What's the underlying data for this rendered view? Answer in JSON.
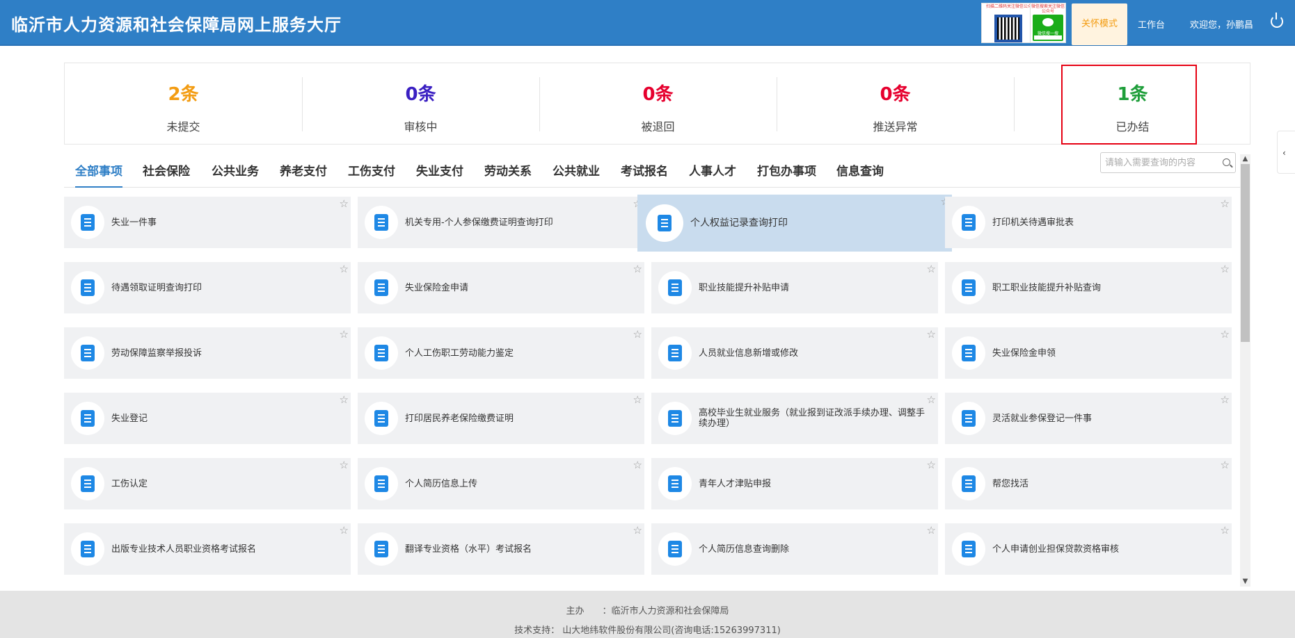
{
  "header": {
    "title": "临沂市人力资源和社会保障局网上服务大厅",
    "qr_caption": "扫描二维码关注微信公众号",
    "wx_caption": "微信搜索关注微信公众号",
    "wx_label": "微信搜一搜",
    "care_mode": "关怀模式",
    "workbench": "工作台",
    "welcome": "欢迎您，孙鹏昌"
  },
  "stats": [
    {
      "count": "2条",
      "label": "未提交",
      "color": "#f39c12"
    },
    {
      "count": "0条",
      "label": "审核中",
      "color": "#3a1fc2"
    },
    {
      "count": "0条",
      "label": "被退回",
      "color": "#e6002e"
    },
    {
      "count": "0条",
      "label": "推送异常",
      "color": "#e6002e"
    },
    {
      "count": "1条",
      "label": "已办结",
      "color": "#1e9e3a"
    }
  ],
  "tabs": [
    "全部事项",
    "社会保险",
    "公共业务",
    "养老支付",
    "工伤支付",
    "失业支付",
    "劳动关系",
    "公共就业",
    "考试报名",
    "人事人才",
    "打包办事项",
    "信息查询"
  ],
  "search": {
    "placeholder": "请输入需要查询的内容"
  },
  "items": [
    "失业一件事",
    "机关专用-个人参保缴费证明查询打印",
    "个人权益记录查询打印",
    "打印机关待遇审批表",
    "待遇领取证明查询打印",
    "失业保险金申请",
    "职业技能提升补贴申请",
    "职工职业技能提升补贴查询",
    "劳动保障监察举报投诉",
    "个人工伤职工劳动能力鉴定",
    "人员就业信息新增或修改",
    "失业保险金申领",
    "失业登记",
    "打印居民养老保险缴费证明",
    "高校毕业生就业服务（就业报到证改派手续办理、调整手续办理）",
    "灵活就业参保登记一件事",
    "工伤认定",
    "个人简历信息上传",
    "青年人才津贴申报",
    "帮您找活",
    "出版专业技术人员职业资格考试报名",
    "翻译专业资格（水平）考试报名",
    "个人简历信息查询删除",
    "个人申请创业担保贷款资格审核"
  ],
  "footer": {
    "sponsor": "主办　　：临沂市人力资源和社会保障局",
    "support": "技术支持：  山大地纬软件股份有限公司(咨询电话:15263997311)"
  }
}
